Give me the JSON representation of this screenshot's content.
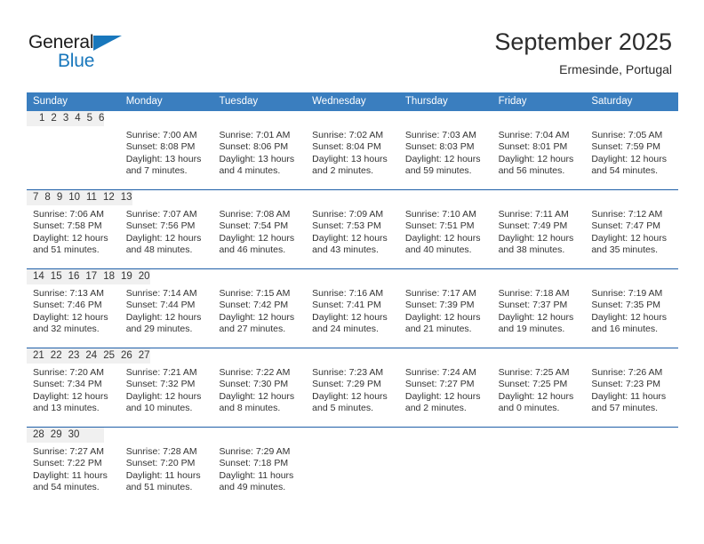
{
  "brand": {
    "name_part1": "General",
    "name_part2": "Blue",
    "triangle_color": "#1877bc",
    "text_color": "#1b1b1b"
  },
  "header": {
    "month_title": "September 2025",
    "location": "Ermesinde, Portugal"
  },
  "theme": {
    "header_blue": "#3a7ebf",
    "row_divider_blue": "#1f5fa8",
    "day_band_gray": "#f0f0f0",
    "text_color": "#333333"
  },
  "weekdays": [
    "Sunday",
    "Monday",
    "Tuesday",
    "Wednesday",
    "Thursday",
    "Friday",
    "Saturday"
  ],
  "weeks": [
    [
      {
        "day": "",
        "lines": [
          "",
          "",
          "",
          ""
        ]
      },
      {
        "day": "1",
        "lines": [
          "Sunrise: 7:00 AM",
          "Sunset: 8:08 PM",
          "Daylight: 13 hours",
          "and 7 minutes."
        ]
      },
      {
        "day": "2",
        "lines": [
          "Sunrise: 7:01 AM",
          "Sunset: 8:06 PM",
          "Daylight: 13 hours",
          "and 4 minutes."
        ]
      },
      {
        "day": "3",
        "lines": [
          "Sunrise: 7:02 AM",
          "Sunset: 8:04 PM",
          "Daylight: 13 hours",
          "and 2 minutes."
        ]
      },
      {
        "day": "4",
        "lines": [
          "Sunrise: 7:03 AM",
          "Sunset: 8:03 PM",
          "Daylight: 12 hours",
          "and 59 minutes."
        ]
      },
      {
        "day": "5",
        "lines": [
          "Sunrise: 7:04 AM",
          "Sunset: 8:01 PM",
          "Daylight: 12 hours",
          "and 56 minutes."
        ]
      },
      {
        "day": "6",
        "lines": [
          "Sunrise: 7:05 AM",
          "Sunset: 7:59 PM",
          "Daylight: 12 hours",
          "and 54 minutes."
        ]
      }
    ],
    [
      {
        "day": "7",
        "lines": [
          "Sunrise: 7:06 AM",
          "Sunset: 7:58 PM",
          "Daylight: 12 hours",
          "and 51 minutes."
        ]
      },
      {
        "day": "8",
        "lines": [
          "Sunrise: 7:07 AM",
          "Sunset: 7:56 PM",
          "Daylight: 12 hours",
          "and 48 minutes."
        ]
      },
      {
        "day": "9",
        "lines": [
          "Sunrise: 7:08 AM",
          "Sunset: 7:54 PM",
          "Daylight: 12 hours",
          "and 46 minutes."
        ]
      },
      {
        "day": "10",
        "lines": [
          "Sunrise: 7:09 AM",
          "Sunset: 7:53 PM",
          "Daylight: 12 hours",
          "and 43 minutes."
        ]
      },
      {
        "day": "11",
        "lines": [
          "Sunrise: 7:10 AM",
          "Sunset: 7:51 PM",
          "Daylight: 12 hours",
          "and 40 minutes."
        ]
      },
      {
        "day": "12",
        "lines": [
          "Sunrise: 7:11 AM",
          "Sunset: 7:49 PM",
          "Daylight: 12 hours",
          "and 38 minutes."
        ]
      },
      {
        "day": "13",
        "lines": [
          "Sunrise: 7:12 AM",
          "Sunset: 7:47 PM",
          "Daylight: 12 hours",
          "and 35 minutes."
        ]
      }
    ],
    [
      {
        "day": "14",
        "lines": [
          "Sunrise: 7:13 AM",
          "Sunset: 7:46 PM",
          "Daylight: 12 hours",
          "and 32 minutes."
        ]
      },
      {
        "day": "15",
        "lines": [
          "Sunrise: 7:14 AM",
          "Sunset: 7:44 PM",
          "Daylight: 12 hours",
          "and 29 minutes."
        ]
      },
      {
        "day": "16",
        "lines": [
          "Sunrise: 7:15 AM",
          "Sunset: 7:42 PM",
          "Daylight: 12 hours",
          "and 27 minutes."
        ]
      },
      {
        "day": "17",
        "lines": [
          "Sunrise: 7:16 AM",
          "Sunset: 7:41 PM",
          "Daylight: 12 hours",
          "and 24 minutes."
        ]
      },
      {
        "day": "18",
        "lines": [
          "Sunrise: 7:17 AM",
          "Sunset: 7:39 PM",
          "Daylight: 12 hours",
          "and 21 minutes."
        ]
      },
      {
        "day": "19",
        "lines": [
          "Sunrise: 7:18 AM",
          "Sunset: 7:37 PM",
          "Daylight: 12 hours",
          "and 19 minutes."
        ]
      },
      {
        "day": "20",
        "lines": [
          "Sunrise: 7:19 AM",
          "Sunset: 7:35 PM",
          "Daylight: 12 hours",
          "and 16 minutes."
        ]
      }
    ],
    [
      {
        "day": "21",
        "lines": [
          "Sunrise: 7:20 AM",
          "Sunset: 7:34 PM",
          "Daylight: 12 hours",
          "and 13 minutes."
        ]
      },
      {
        "day": "22",
        "lines": [
          "Sunrise: 7:21 AM",
          "Sunset: 7:32 PM",
          "Daylight: 12 hours",
          "and 10 minutes."
        ]
      },
      {
        "day": "23",
        "lines": [
          "Sunrise: 7:22 AM",
          "Sunset: 7:30 PM",
          "Daylight: 12 hours",
          "and 8 minutes."
        ]
      },
      {
        "day": "24",
        "lines": [
          "Sunrise: 7:23 AM",
          "Sunset: 7:29 PM",
          "Daylight: 12 hours",
          "and 5 minutes."
        ]
      },
      {
        "day": "25",
        "lines": [
          "Sunrise: 7:24 AM",
          "Sunset: 7:27 PM",
          "Daylight: 12 hours",
          "and 2 minutes."
        ]
      },
      {
        "day": "26",
        "lines": [
          "Sunrise: 7:25 AM",
          "Sunset: 7:25 PM",
          "Daylight: 12 hours",
          "and 0 minutes."
        ]
      },
      {
        "day": "27",
        "lines": [
          "Sunrise: 7:26 AM",
          "Sunset: 7:23 PM",
          "Daylight: 11 hours",
          "and 57 minutes."
        ]
      }
    ],
    [
      {
        "day": "28",
        "lines": [
          "Sunrise: 7:27 AM",
          "Sunset: 7:22 PM",
          "Daylight: 11 hours",
          "and 54 minutes."
        ]
      },
      {
        "day": "29",
        "lines": [
          "Sunrise: 7:28 AM",
          "Sunset: 7:20 PM",
          "Daylight: 11 hours",
          "and 51 minutes."
        ]
      },
      {
        "day": "30",
        "lines": [
          "Sunrise: 7:29 AM",
          "Sunset: 7:18 PM",
          "Daylight: 11 hours",
          "and 49 minutes."
        ]
      },
      {
        "day": "",
        "lines": [
          "",
          "",
          "",
          ""
        ]
      },
      {
        "day": "",
        "lines": [
          "",
          "",
          "",
          ""
        ]
      },
      {
        "day": "",
        "lines": [
          "",
          "",
          "",
          ""
        ]
      },
      {
        "day": "",
        "lines": [
          "",
          "",
          "",
          ""
        ]
      }
    ]
  ]
}
